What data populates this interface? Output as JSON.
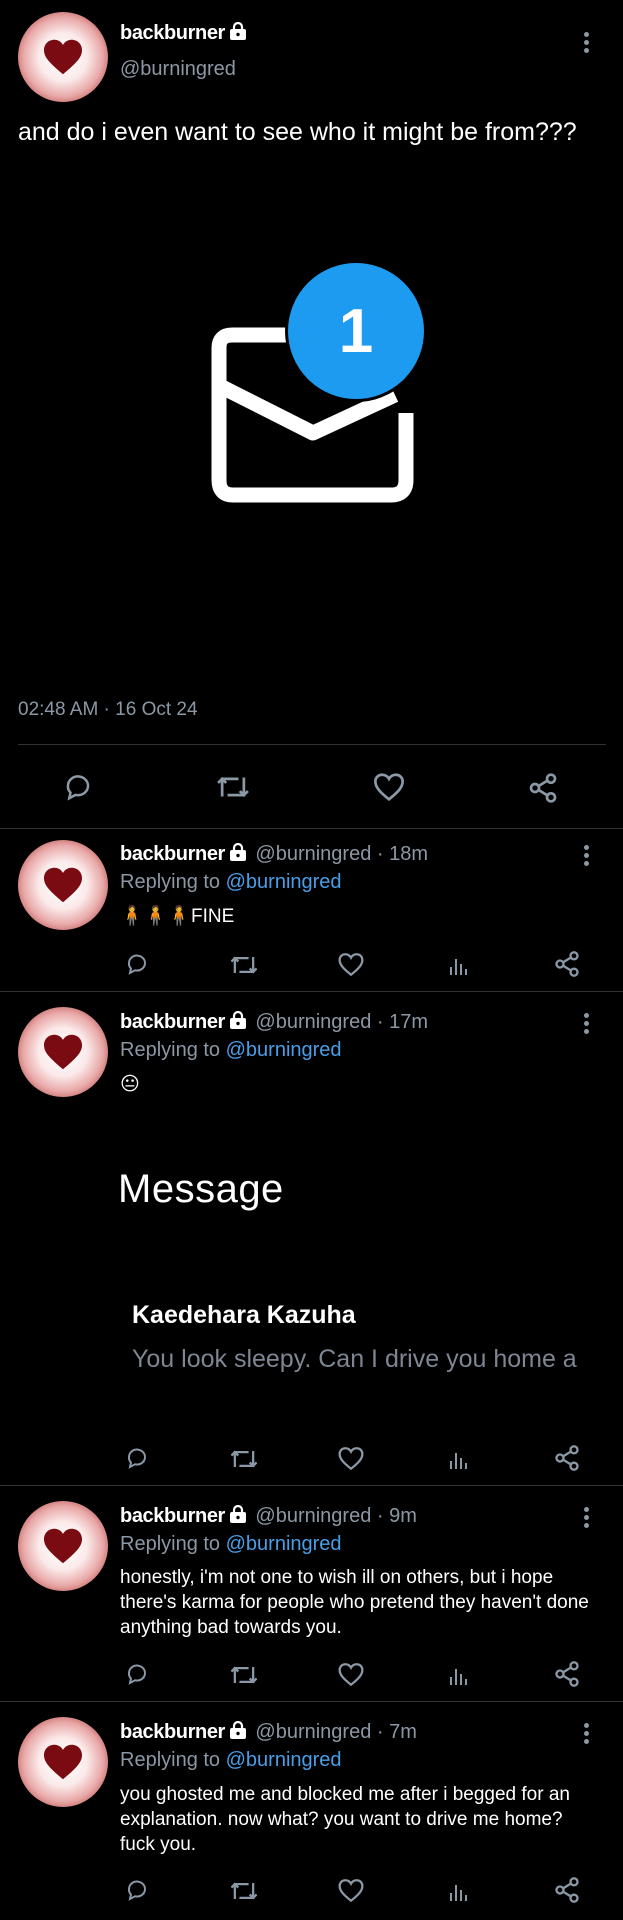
{
  "main_tweet": {
    "display_name": "backburner",
    "handle": "@burningred",
    "text": "and do i even want to see who it might be from???",
    "notification_count": "1",
    "timestamp": "02:48 AM · 16 Oct 24"
  },
  "replies": [
    {
      "display_name": "backburner",
      "meta": "@burningred · 18m",
      "replying_prefix": "Replying to ",
      "replying_to": "@burningred",
      "text": "🧍🧍🧍FINE"
    },
    {
      "display_name": "backburner",
      "meta": "@burningred · 17m",
      "replying_prefix": "Replying to ",
      "replying_to": "@burningred",
      "text": "😐",
      "embedded_image": {
        "title": "Message",
        "sender": "Kaedehara Kazuha",
        "preview": "You look sleepy. Can I drive you home a"
      }
    },
    {
      "display_name": "backburner",
      "meta": "@burningred · 9m",
      "replying_prefix": "Replying to ",
      "replying_to": "@burningred",
      "text": "honestly, i'm not one to wish ill on others, but i hope there's karma for people who pretend they haven't done anything bad towards you."
    },
    {
      "display_name": "backburner",
      "meta": "@burningred · 7m",
      "replying_prefix": "Replying to ",
      "replying_to": "@burningred",
      "text": "you ghosted me and blocked me after i begged for an explanation. now what? you want to drive me home? fuck you."
    }
  ],
  "icons": [
    "heart-avatar-icon",
    "lock-icon",
    "more-icon",
    "reply-icon",
    "retweet-icon",
    "like-icon",
    "analytics-icon",
    "share-icon",
    "envelope-icon"
  ],
  "colors": {
    "background": "#000000",
    "muted": "#8b98a5",
    "link": "#4a9ee8",
    "badge": "#1d9bf0",
    "divider": "#2f3336"
  }
}
